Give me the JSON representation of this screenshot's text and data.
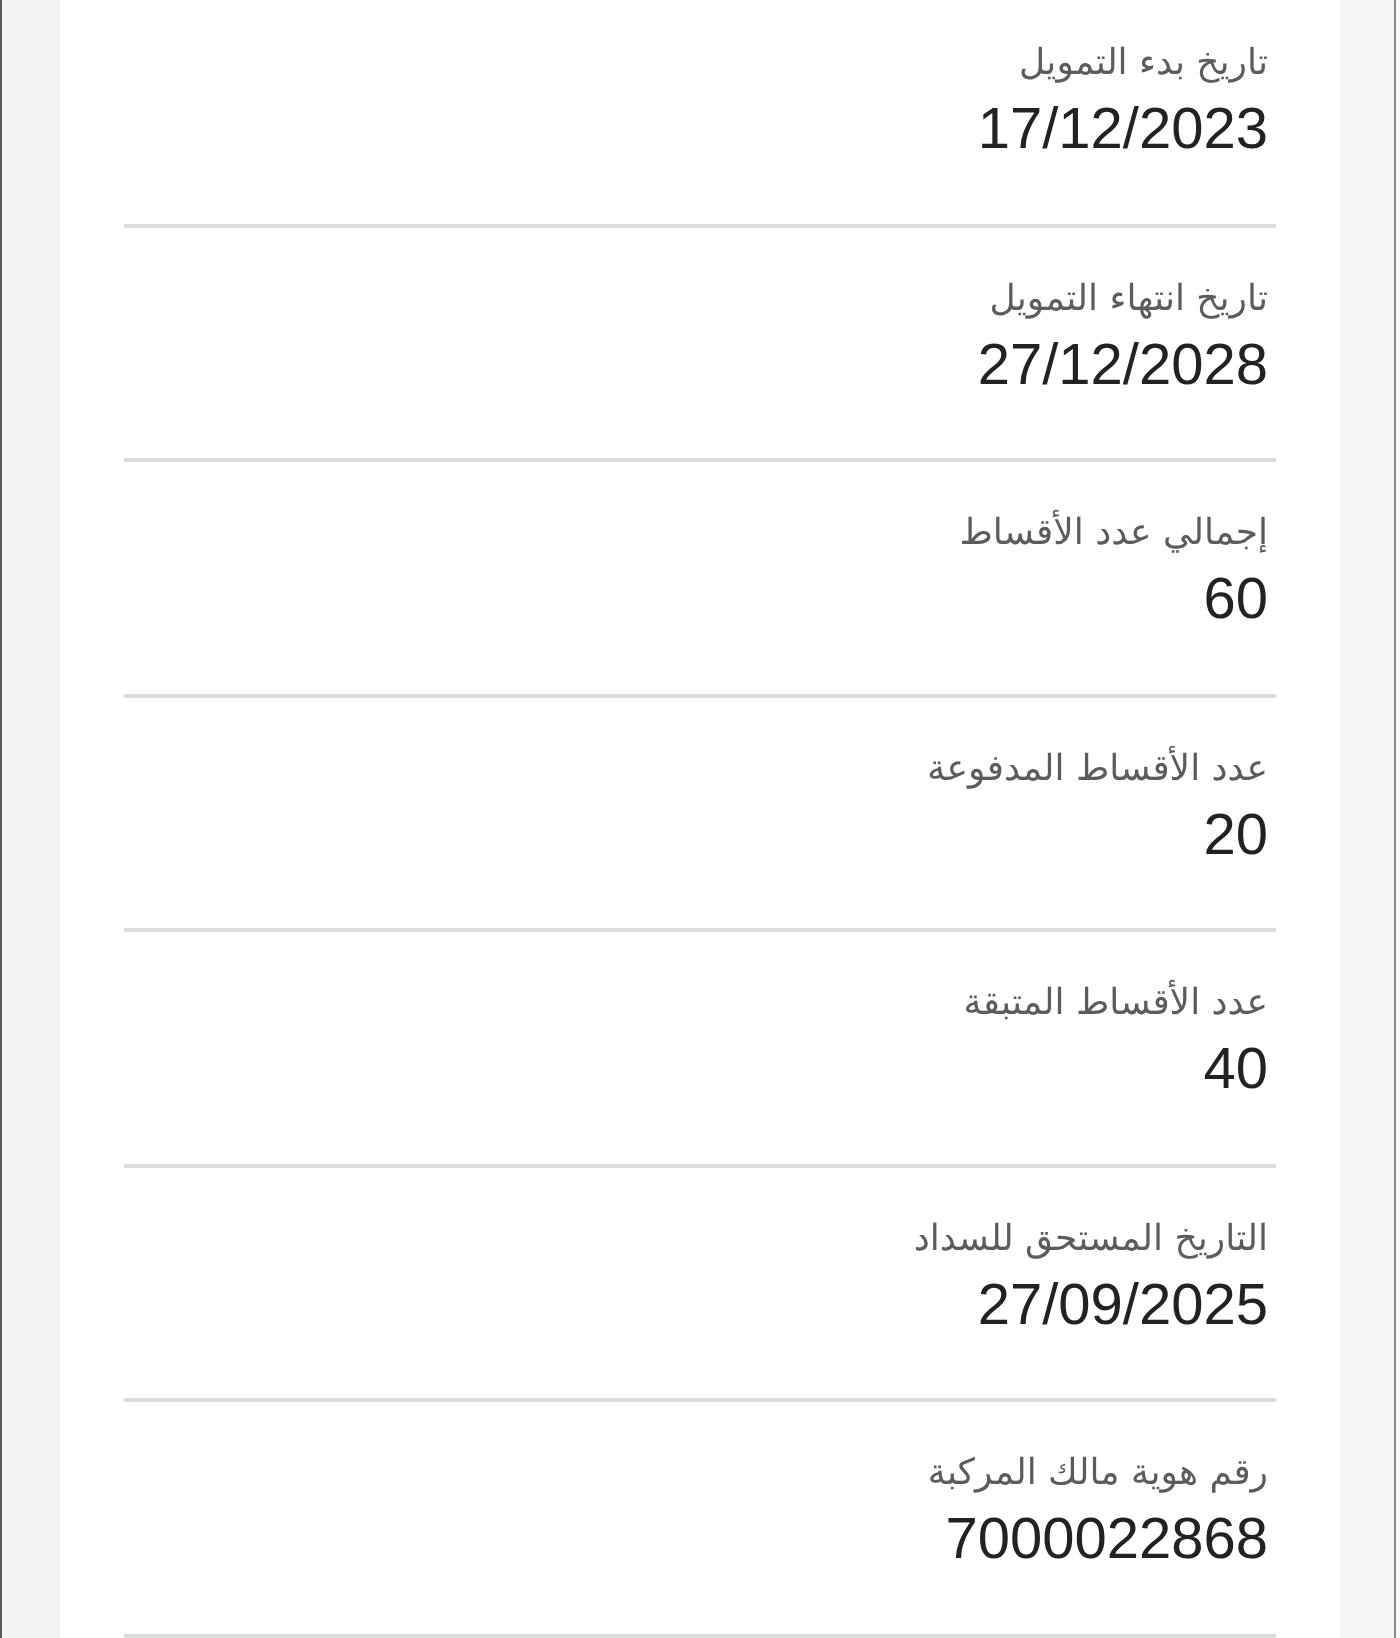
{
  "fields": [
    {
      "label": "تاريخ بدء التمويل",
      "value": "17/12/2023"
    },
    {
      "label": "تاريخ انتهاء التمويل",
      "value": "27/12/2028"
    },
    {
      "label": "إجمالي عدد الأقساط",
      "value": "60"
    },
    {
      "label": "عدد الأقساط المدفوعة",
      "value": "20"
    },
    {
      "label": "عدد الأقساط المتبقة",
      "value": "40"
    },
    {
      "label": "التاريخ المستحق للسداد",
      "value": "27/09/2025"
    },
    {
      "label": "رقم هوية مالك المركبة",
      "value": "7000022868"
    }
  ]
}
